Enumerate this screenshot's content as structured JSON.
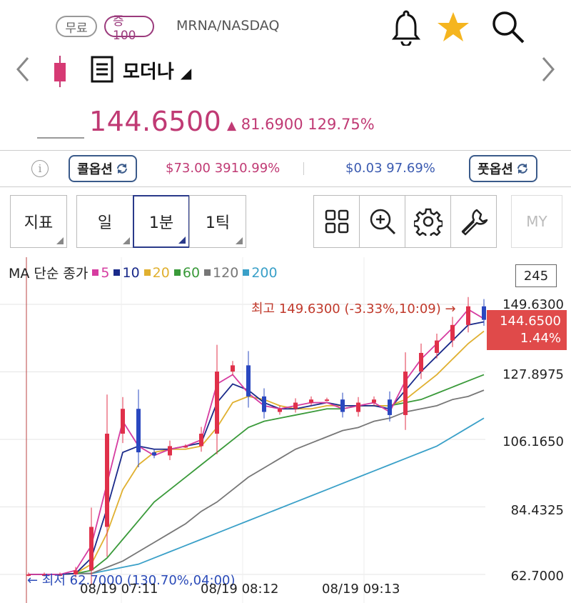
{
  "header": {
    "badge_free": "무료",
    "badge_cert": "증100",
    "symbol": "MRNA/NASDAQ",
    "icons": [
      "bell-icon",
      "star-icon",
      "search-icon"
    ],
    "star_color": "#f5b51f"
  },
  "stock": {
    "name": "모더나",
    "name_arrow": "◢",
    "price": "144.6500",
    "change_arrow": "▲",
    "change": "81.6900",
    "change_pct": "129.75%",
    "up_color": "#c03a74"
  },
  "options": {
    "info": "i",
    "call_label": "콜옵션",
    "call_value": "$73.00",
    "call_pct": "3910.99%",
    "put_label": "풋옵션",
    "put_value": "$0.03",
    "put_pct": "97.69%"
  },
  "toolbar": {
    "indicator": "지표",
    "day": "일",
    "minute": "1분",
    "tick": "1틱",
    "my": "MY"
  },
  "chart": {
    "legend_title": "MA 단순 종가",
    "ma": [
      {
        "label": "5",
        "color": "#d63ca0"
      },
      {
        "label": "10",
        "color": "#1a2a8a"
      },
      {
        "label": "20",
        "color": "#e0b030"
      },
      {
        "label": "60",
        "color": "#3a9a3a"
      },
      {
        "label": "120",
        "color": "#777777"
      },
      {
        "label": "200",
        "color": "#3aa0c8"
      }
    ],
    "count": "245",
    "y_labels": [
      "149.6300",
      "127.8975",
      "106.1650",
      "84.4325",
      "62.7000"
    ],
    "current_price": "144.6500",
    "current_pct": "1.44%",
    "high_label": "최고 149.6300 (-3.33%,10:09) →",
    "low_label": "← 최저 62.7000 (130.70%,04:00)",
    "x_labels": [
      "08/19 07:11",
      "08/19 08:12",
      "08/19 09:13"
    ]
  },
  "chart_data": {
    "type": "line",
    "ylim": [
      62.7,
      149.63
    ],
    "y_ticks": [
      149.63,
      127.8975,
      106.165,
      84.4325,
      62.7
    ],
    "x_ticks": [
      "08/19 07:11",
      "08/19 08:12",
      "08/19 09:13"
    ],
    "x_count": 30,
    "series": [
      {
        "name": "5",
        "values": [
          62.7,
          62.7,
          62.7,
          64,
          72,
          92,
          112,
          104,
          101,
          103,
          104,
          106,
          124,
          127,
          121,
          117,
          116,
          117,
          118,
          118,
          116,
          117,
          118,
          115,
          125,
          132,
          137,
          142,
          148,
          145
        ]
      },
      {
        "name": "10",
        "values": [
          62.7,
          62.7,
          62.7,
          63,
          68,
          84,
          102,
          104,
          103,
          103,
          104,
          105,
          118,
          124,
          122,
          118,
          116,
          116,
          117,
          118,
          117,
          117,
          117,
          116,
          122,
          128,
          133,
          138,
          143,
          144
        ]
      },
      {
        "name": "20",
        "values": [
          62.7,
          62.7,
          62.7,
          63,
          66,
          76,
          90,
          98,
          102,
          103,
          103,
          104,
          110,
          118,
          120,
          119,
          117,
          116,
          116,
          117,
          117,
          117,
          117,
          117,
          119,
          123,
          127,
          132,
          137,
          141
        ]
      },
      {
        "name": "60",
        "values": [
          62.7,
          62.7,
          62.7,
          63,
          64,
          68,
          74,
          80,
          86,
          90,
          94,
          98,
          102,
          106,
          110,
          112,
          113,
          114,
          115,
          116,
          116,
          117,
          117,
          117,
          118,
          119,
          121,
          123,
          125,
          127
        ]
      },
      {
        "name": "120",
        "values": [
          62.7,
          62.7,
          62.7,
          63,
          63,
          65,
          67,
          70,
          73,
          76,
          79,
          83,
          86,
          90,
          94,
          97,
          100,
          103,
          105,
          107,
          109,
          110,
          112,
          113,
          115,
          116,
          117,
          119,
          120,
          122
        ]
      },
      {
        "name": "200",
        "values": [
          62.7,
          62.7,
          62.7,
          63,
          63,
          64,
          65,
          66,
          68,
          70,
          72,
          74,
          76,
          78,
          80,
          82,
          84,
          86,
          88,
          90,
          92,
          94,
          96,
          98,
          100,
          102,
          104,
          107,
          110,
          113
        ]
      }
    ],
    "candles": [
      62.7,
      62.7,
      62.7,
      64,
      78,
      108,
      116,
      102,
      101,
      104,
      104,
      108,
      128,
      130,
      120,
      115,
      116,
      118,
      119,
      119,
      115,
      118,
      119,
      114,
      128,
      134,
      138,
      143,
      149,
      144.65
    ]
  }
}
